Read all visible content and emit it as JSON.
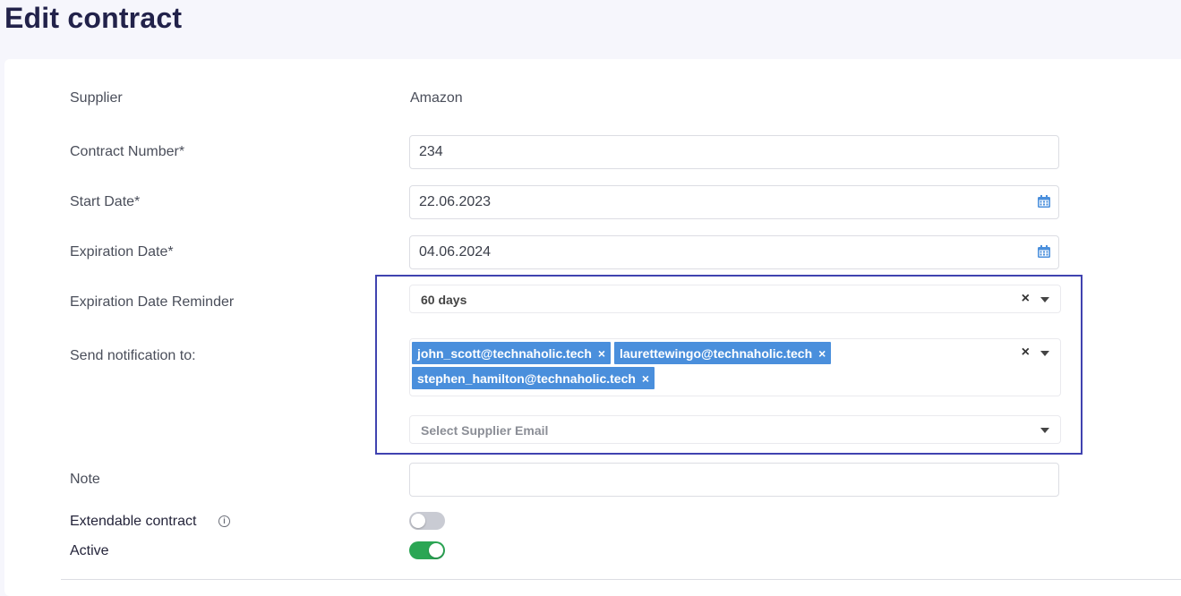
{
  "page": {
    "title": "Edit contract"
  },
  "form": {
    "supplier": {
      "label": "Supplier",
      "value": "Amazon"
    },
    "contract_number": {
      "label": "Contract Number*",
      "value": "234"
    },
    "start_date": {
      "label": "Start Date*",
      "value": "22.06.2023",
      "icon": "calendar-icon"
    },
    "expiration_date": {
      "label": "Expiration Date*",
      "value": "04.06.2024",
      "icon": "calendar-icon"
    },
    "reminder": {
      "label": "Expiration Date Reminder",
      "value": "60 days"
    },
    "notification": {
      "label": "Send notification to:",
      "emails": [
        "john_scott@technaholic.tech",
        "laurettewingo@technaholic.tech",
        "stephen_hamilton@technaholic.tech"
      ],
      "supplier_email_placeholder": "Select Supplier Email"
    },
    "note": {
      "label": "Note",
      "value": ""
    },
    "extendable": {
      "label": "Extendable contract",
      "enabled": false
    },
    "active": {
      "label": "Active",
      "enabled": true
    }
  },
  "colors": {
    "accent": "#4a8fdc",
    "toggle_on": "#2ba654",
    "highlight": "#4043b0"
  },
  "remove_glyph": "×"
}
